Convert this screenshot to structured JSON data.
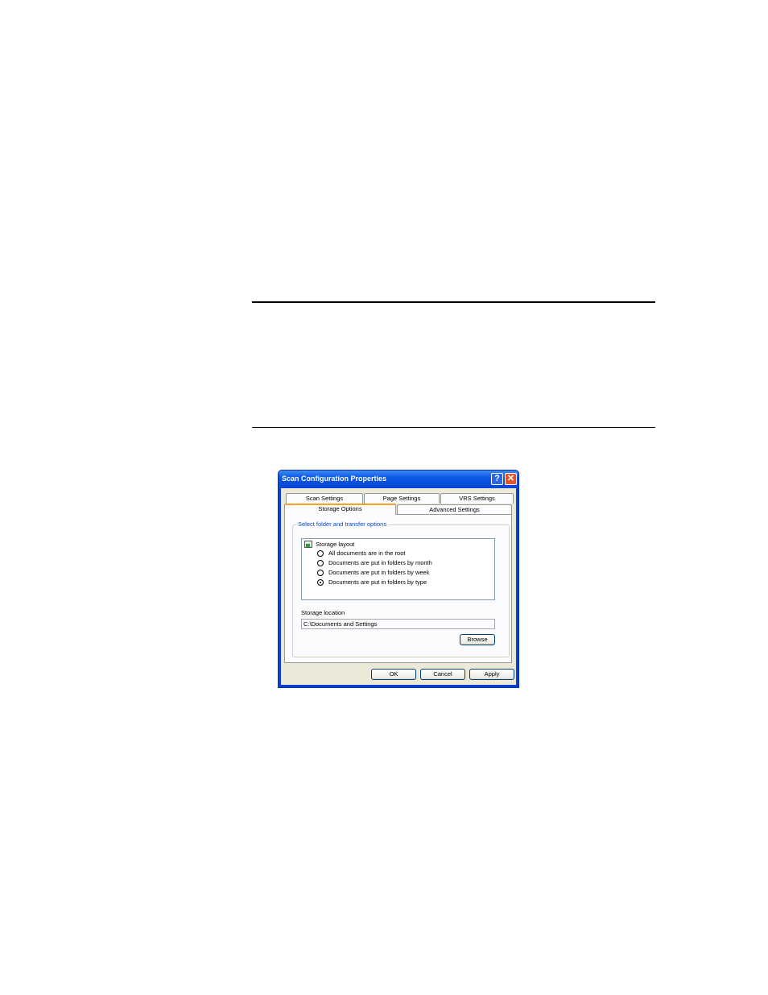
{
  "dialog": {
    "title": "Scan Configuration Properties",
    "help_label": "?",
    "close_label": "✕",
    "tabs": [
      {
        "label": "Scan Settings"
      },
      {
        "label": "Page Settings"
      },
      {
        "label": "VRS Settings"
      },
      {
        "label": "Storage Options",
        "active": true
      },
      {
        "label": "Advanced Settings"
      }
    ],
    "group_title": "Select folder and transfer options",
    "storage_layout_label": "Storage layout",
    "options": [
      {
        "label": "All documents are in the root",
        "selected": false
      },
      {
        "label": "Documents are put in folders by month",
        "selected": false
      },
      {
        "label": "Documents are put in folders by week",
        "selected": false
      },
      {
        "label": "Documents are put in folders by type",
        "selected": true
      }
    ],
    "storage_location_label": "Storage location",
    "storage_location_value": "C:\\Documents and Settings",
    "browse_label": "Browse",
    "ok_label": "OK",
    "cancel_label": "Cancel",
    "apply_label": "Apply"
  }
}
